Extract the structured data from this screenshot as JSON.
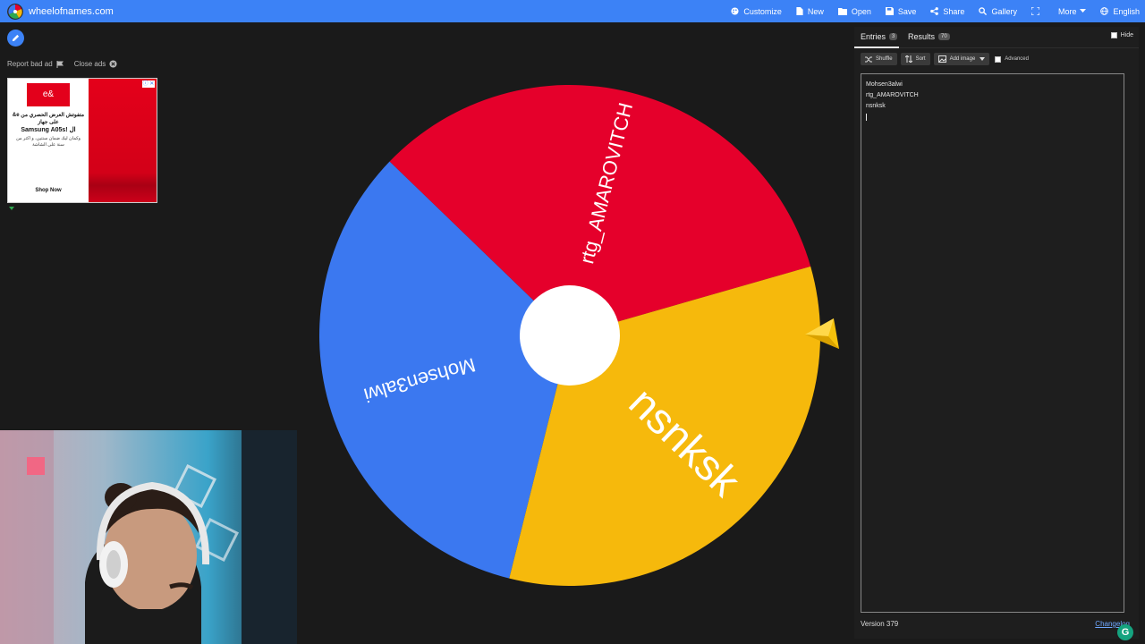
{
  "brand": {
    "title": "wheelofnames.com"
  },
  "nav": {
    "customize": "Customize",
    "new": "New",
    "open": "Open",
    "save": "Save",
    "share": "Share",
    "gallery": "Gallery",
    "more": "More",
    "language": "English"
  },
  "ads": {
    "report": "Report bad ad",
    "close": "Close ads",
    "logo": "e&",
    "headline": "متفوتش العرض الحصري من e& على جهاز",
    "headline2": "Samsung A05s! ال",
    "sub": "وكمان ليك ضمان سنتين، و اكتر من سنة على الشاشة",
    "shop": "Shop Now",
    "badge": "ⓘ ✕"
  },
  "wheel": {
    "segments": [
      {
        "label": "Mohsen3alwi",
        "color": "#3b78f0"
      },
      {
        "label": "rtg_AMAROVITCH",
        "color": "#e5002b"
      },
      {
        "label": "nsnksk",
        "color": "#f6b90c"
      }
    ],
    "hub_color": "#ffffff",
    "pointer_color": "#f6c20c"
  },
  "panel": {
    "tab_entries": "Entries",
    "entries_count": "3",
    "tab_results": "Results",
    "results_count": "70",
    "hide": "Hide",
    "shuffle": "Shuffle",
    "sort": "Sort",
    "add_image": "Add image",
    "advanced": "Advanced",
    "entries": [
      "Mohsen3alwi",
      "rtg_AMAROVITCH",
      "nsnksk"
    ],
    "version": "Version 379",
    "changelog": "Changelog"
  },
  "grammarly": {
    "letter": "G"
  }
}
